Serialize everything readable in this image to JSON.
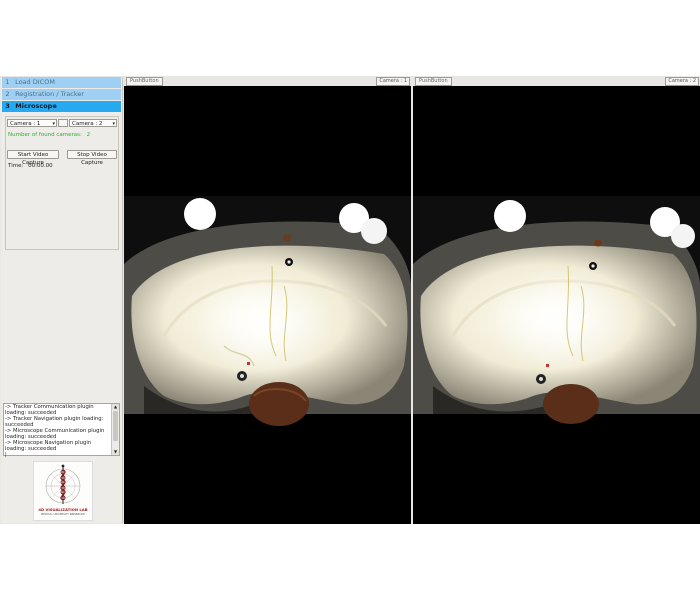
{
  "steps": [
    {
      "num": "1",
      "label": "Load DICOM"
    },
    {
      "num": "2",
      "label": "Registration / Tracker"
    },
    {
      "num": "3",
      "label": "Microscope"
    }
  ],
  "camera_controls": {
    "camera_left": "Camera : 1",
    "camera_right": "Camera : 2",
    "found_label": "Number of found cameras:",
    "found_count": "2",
    "start_capture": "Start Video Capture",
    "stop_capture": "Stop Video Capture",
    "time_label": "Time:",
    "time_value": "00:00.00"
  },
  "log_lines": [
    "-> Tracker Communication plugin loading: succeeded",
    "-> Tracker Navigation plugin loading: succeeded",
    "-> Microscope Communication plugin loading: succeeded",
    "-> Microscope Navigation plugin loading: succeeded"
  ],
  "logo": {
    "title": "4D VISUALIZATION LAB",
    "subtitle": "MEDICAL UNIVERSITY INNSBRUCK"
  },
  "viewports": [
    {
      "button": "PushButton",
      "camera": "Camera : 1"
    },
    {
      "button": "PushButton",
      "camera": "Camera : 2"
    }
  ],
  "icons": {
    "dropdown": "chevron-down-icon",
    "scroll_up": "arrow-up-icon",
    "scroll_down": "arrow-down-icon"
  },
  "colors": {
    "step_inactive": "#9fd0f3",
    "step_active": "#26a9f0",
    "found_text": "#2bb32b"
  }
}
